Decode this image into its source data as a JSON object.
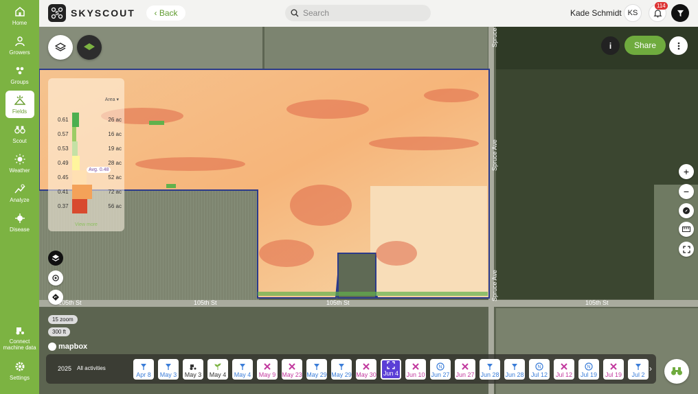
{
  "app": {
    "brand": "SKYSCOUT"
  },
  "header": {
    "back_label": "Back",
    "search_placeholder": "Search",
    "user_name": "Kade Schmidt",
    "user_initials": "KS",
    "notification_count": "114"
  },
  "sidebar": {
    "items": [
      {
        "label": "Home",
        "icon": "home-icon"
      },
      {
        "label": "Growers",
        "icon": "people-icon"
      },
      {
        "label": "Groups",
        "icon": "groups-icon"
      },
      {
        "label": "Fields",
        "icon": "field-icon",
        "active": true
      },
      {
        "label": "Scout",
        "icon": "binoculars-icon"
      },
      {
        "label": "Weather",
        "icon": "sun-icon"
      },
      {
        "label": "Analyze",
        "icon": "analyze-icon"
      },
      {
        "label": "Disease",
        "icon": "virus-icon"
      }
    ],
    "bottom": [
      {
        "label": "Connect machine data",
        "icon": "tractor-icon"
      },
      {
        "label": "Settings",
        "icon": "gear-icon"
      }
    ]
  },
  "map": {
    "share_label": "Share",
    "zoom_level": "15 zoom",
    "scale": "300 ft",
    "attribution": "mapbox",
    "street_labels": [
      "105th St",
      "105th St",
      "105th St",
      "105th St",
      "Spruce Ave",
      "Spruce Ave",
      "Spruce Ave"
    ]
  },
  "legend": {
    "sort_label": "Area",
    "avg_label": "Avg. 0.48",
    "footer": "View more",
    "rows": [
      {
        "value": "0.61",
        "area": "26 ac",
        "color": "#4caf50",
        "share": 0.26
      },
      {
        "value": "0.57",
        "area": "16 ac",
        "color": "#9ccc65",
        "share": 0.16
      },
      {
        "value": "0.53",
        "area": "19 ac",
        "color": "#c5e1a5",
        "share": 0.19
      },
      {
        "value": "0.49",
        "area": "28 ac",
        "color": "#fff59d",
        "share": 0.28
      },
      {
        "value": "0.45",
        "area": "52 ac",
        "color": "#ffe0b2",
        "share": 0.52
      },
      {
        "value": "0.41",
        "area": "72 ac",
        "color": "#f4a259",
        "share": 0.72
      },
      {
        "value": "0.37",
        "area": "56 ac",
        "color": "#d84a2f",
        "share": 0.56
      }
    ]
  },
  "timeline": {
    "year": "2025",
    "filter": "All activities",
    "chips": [
      {
        "label": "Apr 8",
        "icon": "drone-icon",
        "color": "#3b7dd8"
      },
      {
        "label": "May 3",
        "icon": "drone-icon",
        "color": "#3b7dd8"
      },
      {
        "label": "May 3",
        "icon": "tractor-icon",
        "color": "#333333"
      },
      {
        "label": "May 4",
        "icon": "sprout-icon",
        "color": "#333333"
      },
      {
        "label": "May 4",
        "icon": "drone-icon",
        "color": "#3b7dd8"
      },
      {
        "label": "May 9",
        "icon": "cross-icon",
        "color": "#c2399e"
      },
      {
        "label": "May 23",
        "icon": "cross-icon",
        "color": "#c2399e"
      },
      {
        "label": "May 29",
        "icon": "drone-icon",
        "color": "#3b7dd8"
      },
      {
        "label": "May 29",
        "icon": "drone-icon",
        "color": "#3b7dd8"
      },
      {
        "label": "May 30",
        "icon": "cross-icon",
        "color": "#c2399e"
      },
      {
        "label": "Jun 4",
        "icon": "expand-icon",
        "color": "#ffffff",
        "selected": true
      },
      {
        "label": "Jun 10",
        "icon": "cross-icon",
        "color": "#c2399e"
      },
      {
        "label": "Jun 27",
        "icon": "n-icon",
        "color": "#3b7dd8"
      },
      {
        "label": "Jun 27",
        "icon": "cross-icon",
        "color": "#c2399e"
      },
      {
        "label": "Jun 28",
        "icon": "drone-icon",
        "color": "#3b7dd8"
      },
      {
        "label": "Jun 28",
        "icon": "drone-icon",
        "color": "#3b7dd8"
      },
      {
        "label": "Jul 12",
        "icon": "n-icon",
        "color": "#3b7dd8"
      },
      {
        "label": "Jul 12",
        "icon": "cross-icon",
        "color": "#c2399e"
      },
      {
        "label": "Jul 19",
        "icon": "n-icon",
        "color": "#3b7dd8"
      },
      {
        "label": "Jul 19",
        "icon": "cross-icon",
        "color": "#c2399e"
      },
      {
        "label": "Jul 2",
        "icon": "drone-icon",
        "color": "#3b7dd8"
      }
    ]
  }
}
